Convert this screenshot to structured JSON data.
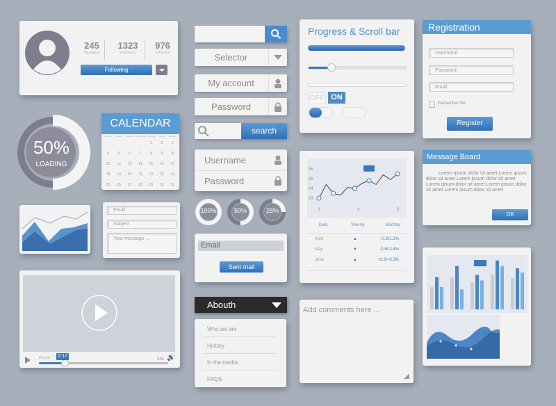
{
  "profile": {
    "stats": [
      {
        "value": "245",
        "label": "Messages"
      },
      {
        "value": "1323",
        "label": "Followers"
      },
      {
        "value": "976",
        "label": "Following"
      }
    ],
    "follow_button": "Following"
  },
  "loader": {
    "percent_text": "50%",
    "label": "LOADING",
    "progress": 0.5
  },
  "calendar": {
    "title": "CALENDAR",
    "weekdays": [
      "Sunday",
      "Monday",
      "Tuesday",
      "Wednesday",
      "Thursday",
      "Friday",
      "Saturday"
    ],
    "weeks": [
      [
        "",
        "",
        "",
        "",
        "1",
        "2",
        "3"
      ],
      [
        "4",
        "5",
        "6",
        "7",
        "8",
        "9",
        "10"
      ],
      [
        "11",
        "12",
        "13",
        "14",
        "15",
        "16",
        "17"
      ],
      [
        "18",
        "19",
        "20",
        "21",
        "22",
        "23",
        "24"
      ],
      [
        "25",
        "26",
        "27",
        "28",
        "29",
        "30",
        "31"
      ]
    ]
  },
  "contact_form": {
    "email_placeholder": "Email",
    "subject_placeholder": "Subject",
    "message_placeholder": "Your message ..."
  },
  "video": {
    "current_time": "2:17",
    "total_time": "3:56",
    "playlist_label": "Playlist",
    "progress": 0.2
  },
  "controls": {
    "selector_label": "Selector",
    "account_label": "My account",
    "password_label": "Password",
    "search_button": "search",
    "login_username": "Username",
    "login_password": "Password",
    "progress_rings": [
      {
        "text": "100%",
        "value": 1.0
      },
      {
        "text": "50%",
        "value": 0.5
      },
      {
        "text": "25%",
        "value": 0.25
      }
    ],
    "mail_email_placeholder": "Email",
    "sent_mail_button": "Sent mail"
  },
  "about_menu": {
    "title": "Abouth",
    "items": [
      "Who we are",
      "History",
      "In the media",
      "FAQS"
    ]
  },
  "progress_panel": {
    "title": "Progress & Scroll bar",
    "progress": 1.0,
    "slider": 0.2,
    "off_label": "OFF",
    "on_label": "ON"
  },
  "stats_panel": {
    "y_ticks": [
      "86",
      "85",
      "84",
      "83"
    ],
    "x_ticks": [
      "3",
      "4",
      "5"
    ],
    "tabs": [
      "Daily",
      "Weekly",
      "Monthly"
    ],
    "rows": [
      {
        "month": "April",
        "trend": "up",
        "value": "+1.9/1.2%"
      },
      {
        "month": "May",
        "trend": "down",
        "value": "-0.6/-3.4%"
      },
      {
        "month": "June",
        "trend": "up",
        "value": "+2.6/+6.3%"
      }
    ],
    "line": [
      83.0,
      84.4,
      83.5,
      83.3,
      84.1,
      84.0,
      84.5,
      84.8,
      84.4,
      85.4,
      84.9,
      85.5
    ]
  },
  "comments": {
    "placeholder": "Add comments here ..."
  },
  "registration": {
    "title": "Registration",
    "username_placeholder": "Username",
    "password_placeholder": "Password",
    "email_placeholder": "Email",
    "remember_label": "Remember Me",
    "register_button": "Register"
  },
  "message_board": {
    "title": "Message Board",
    "body": "Lorem ipsum dolor sit amet Lorem ipsum dolor sit amet Lorem ipsum dolor sit amet Lorem ipsum dolor sit amet Lorem ipsum dolor sit amet Lorem ipsum dolor sit amet",
    "ok_button": "OK"
  },
  "bar_panel": {
    "groups": [
      [
        40,
        58,
        40
      ],
      [
        58,
        78,
        36
      ],
      [
        48,
        62,
        52
      ],
      [
        62,
        88,
        78
      ],
      [
        56,
        74,
        66
      ]
    ]
  }
}
